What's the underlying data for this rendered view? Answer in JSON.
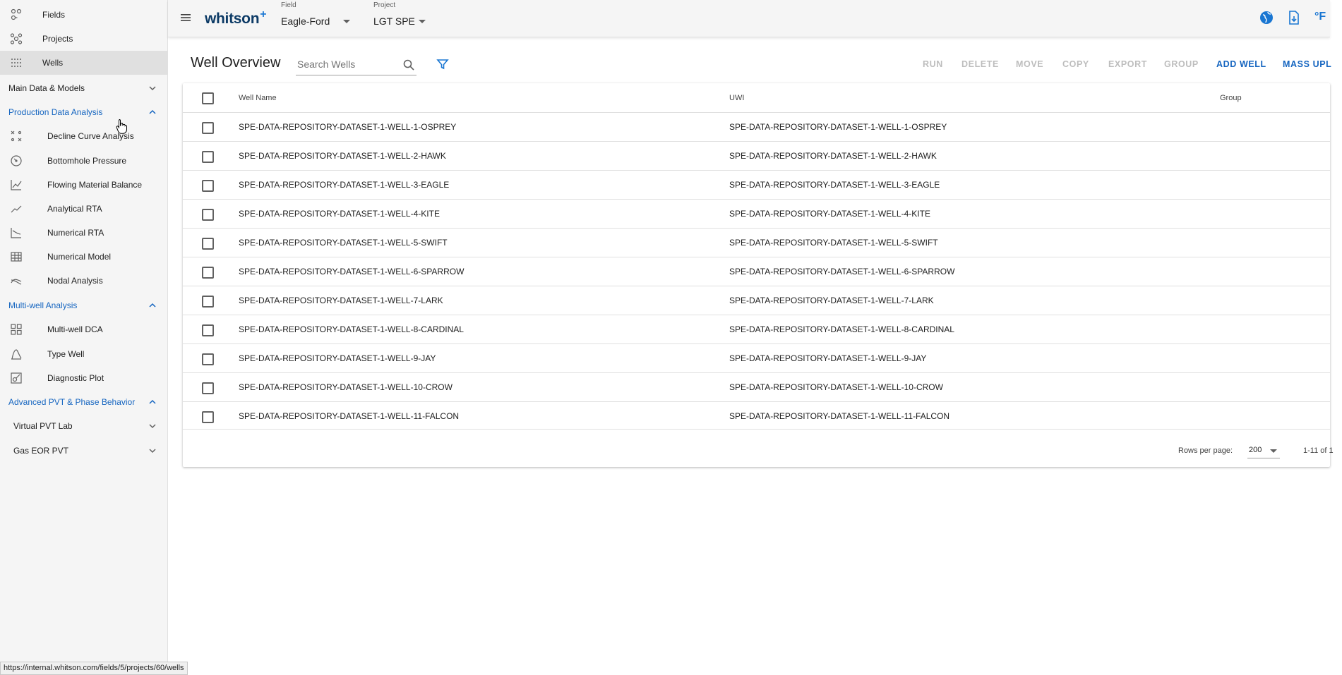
{
  "sidebar": {
    "top_items": [
      {
        "label": "Fields",
        "icon": "fields-icon"
      },
      {
        "label": "Projects",
        "icon": "projects-icon"
      },
      {
        "label": "Wells",
        "icon": "wells-icon",
        "active": true
      }
    ],
    "sections": {
      "main": {
        "label": "Main Data & Models"
      },
      "pda": {
        "label": "Production Data Analysis",
        "items": [
          {
            "label": "Decline Curve Analysis",
            "icon": "decline-curve-icon"
          },
          {
            "label": "Bottomhole Pressure",
            "icon": "gauge-icon"
          },
          {
            "label": "Flowing Material Balance",
            "icon": "line-chart-icon"
          },
          {
            "label": "Analytical RTA",
            "icon": "trend-line-icon"
          },
          {
            "label": "Numerical RTA",
            "icon": "rta-chart-icon"
          },
          {
            "label": "Numerical Model",
            "icon": "grid-model-icon"
          },
          {
            "label": "Nodal Analysis",
            "icon": "nodal-icon"
          }
        ]
      },
      "mwa": {
        "label": "Multi-well Analysis",
        "items": [
          {
            "label": "Multi-well DCA",
            "icon": "grid-four-icon"
          },
          {
            "label": "Type Well",
            "icon": "type-curve-icon"
          },
          {
            "label": "Diagnostic Plot",
            "icon": "diagnostic-icon"
          }
        ]
      },
      "pvt": {
        "label": "Advanced PVT & Phase Behavior",
        "subitems": [
          {
            "label": "Virtual PVT Lab"
          },
          {
            "label": "Gas EOR PVT"
          }
        ]
      }
    }
  },
  "header": {
    "brand": "whitson",
    "brand_plus": "+",
    "field_label": "Field",
    "field_value": "Eagle-Ford",
    "project_label": "Project",
    "project_value": "LGT SPE",
    "unit": "°F"
  },
  "toolbar": {
    "title": "Well Overview",
    "search_placeholder": "Search Wells",
    "actions": {
      "run": "RUN",
      "delete": "DELETE",
      "move": "MOVE",
      "copy": "COPY",
      "export": "EXPORT",
      "group": "GROUP",
      "add_well": "ADD WELL",
      "mass_upload": "MASS UPL"
    }
  },
  "table": {
    "columns": {
      "name": "Well Name",
      "uwi": "UWI",
      "group": "Group"
    },
    "rows": [
      {
        "name": "SPE-DATA-REPOSITORY-DATASET-1-WELL-1-OSPREY",
        "uwi": "SPE-DATA-REPOSITORY-DATASET-1-WELL-1-OSPREY"
      },
      {
        "name": "SPE-DATA-REPOSITORY-DATASET-1-WELL-2-HAWK",
        "uwi": "SPE-DATA-REPOSITORY-DATASET-1-WELL-2-HAWK"
      },
      {
        "name": "SPE-DATA-REPOSITORY-DATASET-1-WELL-3-EAGLE",
        "uwi": "SPE-DATA-REPOSITORY-DATASET-1-WELL-3-EAGLE"
      },
      {
        "name": "SPE-DATA-REPOSITORY-DATASET-1-WELL-4-KITE",
        "uwi": "SPE-DATA-REPOSITORY-DATASET-1-WELL-4-KITE"
      },
      {
        "name": "SPE-DATA-REPOSITORY-DATASET-1-WELL-5-SWIFT",
        "uwi": "SPE-DATA-REPOSITORY-DATASET-1-WELL-5-SWIFT"
      },
      {
        "name": "SPE-DATA-REPOSITORY-DATASET-1-WELL-6-SPARROW",
        "uwi": "SPE-DATA-REPOSITORY-DATASET-1-WELL-6-SPARROW"
      },
      {
        "name": "SPE-DATA-REPOSITORY-DATASET-1-WELL-7-LARK",
        "uwi": "SPE-DATA-REPOSITORY-DATASET-1-WELL-7-LARK"
      },
      {
        "name": "SPE-DATA-REPOSITORY-DATASET-1-WELL-8-CARDINAL",
        "uwi": "SPE-DATA-REPOSITORY-DATASET-1-WELL-8-CARDINAL"
      },
      {
        "name": "SPE-DATA-REPOSITORY-DATASET-1-WELL-9-JAY",
        "uwi": "SPE-DATA-REPOSITORY-DATASET-1-WELL-9-JAY"
      },
      {
        "name": "SPE-DATA-REPOSITORY-DATASET-1-WELL-10-CROW",
        "uwi": "SPE-DATA-REPOSITORY-DATASET-1-WELL-10-CROW"
      },
      {
        "name": "SPE-DATA-REPOSITORY-DATASET-1-WELL-11-FALCON",
        "uwi": "SPE-DATA-REPOSITORY-DATASET-1-WELL-11-FALCON"
      }
    ],
    "footer": {
      "rows_per_page_label": "Rows per page:",
      "rows_per_page_value": "200",
      "range": "1-11 of 1"
    }
  },
  "statusbar": {
    "url": "https://internal.whitson.com/fields/5/projects/60/wells"
  },
  "colors": {
    "accent": "#1565c0",
    "brand": "#0d3b66",
    "disabled_action": "#bdbdbd",
    "sidebar_bg": "#f5f5f5"
  }
}
